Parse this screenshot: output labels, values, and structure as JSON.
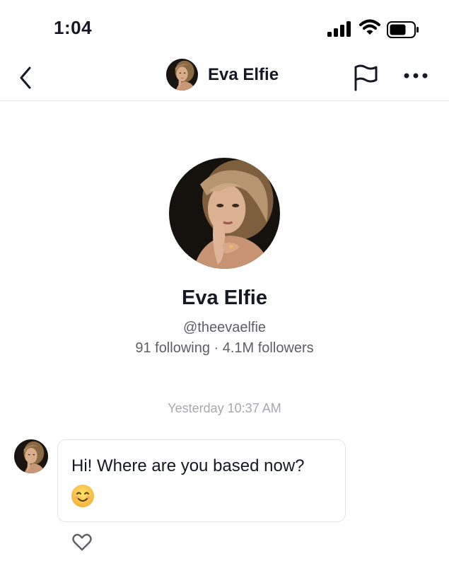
{
  "status_bar": {
    "time": "1:04"
  },
  "header": {
    "name": "Eva Elfie"
  },
  "profile": {
    "name": "Eva Elfie",
    "handle": "@theevaelfie",
    "stats": "91 following · 4.1M followers"
  },
  "chat": {
    "timestamp": "Yesterday 10:37 AM",
    "messages": [
      {
        "text": "Hi! Where are you based now?"
      }
    ]
  },
  "colors": {
    "primary_text": "#161823",
    "secondary_text": "#5d5e66",
    "timestamp": "#a7a8ad",
    "divider": "#e6e6e8"
  },
  "icons": [
    "back-chevron-icon",
    "report-flag-icon",
    "more-dots-icon",
    "smile-emoji-icon",
    "heart-icon",
    "signal-icon",
    "wifi-icon",
    "battery-icon"
  ]
}
